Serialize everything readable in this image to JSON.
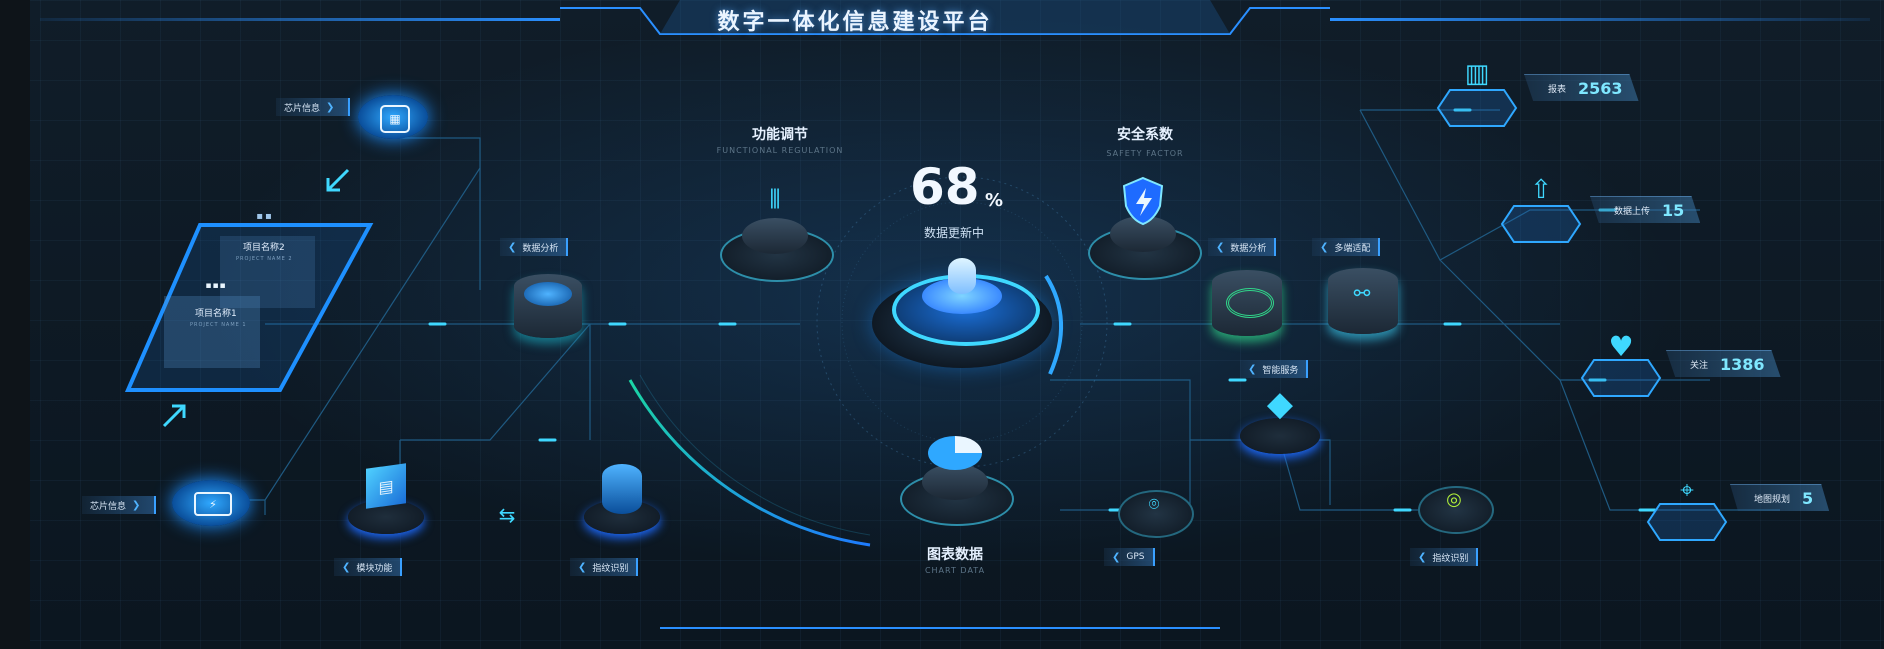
{
  "header": {
    "title": "数字一体化信息建设平台"
  },
  "colors": {
    "accent": "#1e90ff",
    "cyan": "#3fd8ff",
    "green": "#31d68a",
    "background": "#0b1620"
  },
  "left": {
    "chip_info_top": "芯片信息",
    "chip_info_bottom": "芯片信息",
    "project2_name": "项目名称2",
    "project2_sub": "PROJECT NAME 2",
    "project1_name": "项目名称1",
    "project1_sub": "PROJECT NAME 1",
    "data_analysis": "数据分析",
    "module_function": "模块功能",
    "fingerprint": "指纹识别"
  },
  "center": {
    "functional_title": "功能调节",
    "functional_sub": "FUNCTIONAL REGULATION",
    "safety_title": "安全系数",
    "safety_sub": "SAFETY FACTOR",
    "percent_value": "68",
    "percent_sign": "%",
    "percent_label": "数据更新中",
    "progress": 0.68,
    "chart_title": "图表数据",
    "chart_sub": "CHART DATA"
  },
  "right": {
    "data_analysis": "数据分析",
    "multi_adapt": "多端适配",
    "smart_service": "智能服务",
    "gps": "GPS",
    "fingerprint": "指纹识别"
  },
  "stats": [
    {
      "label": "报表",
      "value": "2563",
      "icon": "report-bar-icon"
    },
    {
      "label": "数据上传",
      "value": "15",
      "icon": "upload-icon"
    },
    {
      "label": "关注",
      "value": "1386",
      "icon": "heart-icon"
    },
    {
      "label": "地图规划",
      "value": "5",
      "icon": "map-icon"
    }
  ]
}
